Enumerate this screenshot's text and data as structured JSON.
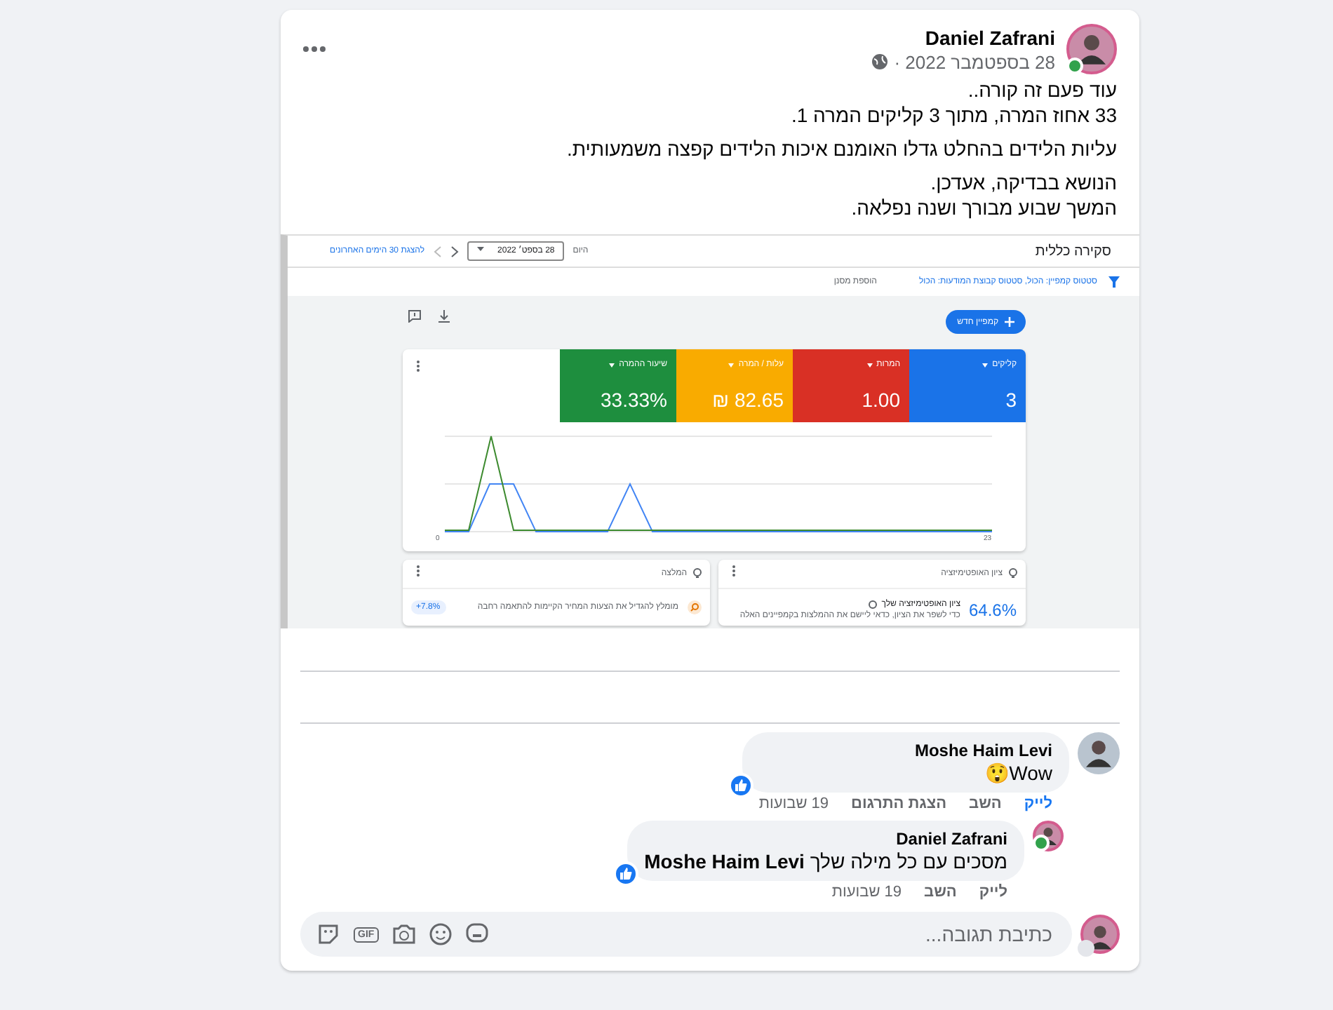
{
  "post": {
    "author": "Daniel Zafrani",
    "date": "28 בספטמבר 2022 ·",
    "online": true,
    "paragraphs": [
      [
        "עוד פעם זה קורה..",
        "33 אחוז המרה, מתוך 3 קליקים המרה 1."
      ],
      [
        "עליות הלידים בהחלט גדלו האומנם איכות הלידים קפצה משמעותית."
      ],
      [
        "הנושא בבדיקה, אעדכן.",
        "המשך שבוע מבורך ושנה נפלאה."
      ]
    ]
  },
  "screenshot": {
    "title": "סקירה כללית",
    "range_label": "היום",
    "date": "28 בספט׳ 2022",
    "range_link": "להצגת 30 הימים האחרונים",
    "filter": "סטטוס קמפיין: הכול, סטטוס קבוצת המודעות: הכול",
    "add_filter": "הוספת מסנן",
    "new_campaign": "קמפיין חדש",
    "tiles": [
      {
        "label": "קליקים",
        "value": "3",
        "color": "#1a73e8"
      },
      {
        "label": "המרות",
        "value": "1.00",
        "color": "#d93025"
      },
      {
        "label": "עלות / המרה",
        "value": "‏82.65 ₪",
        "color": "#f9ab00"
      },
      {
        "label": "שיעור ההמרה",
        "value": "33.33%",
        "color": "#1e8e3e"
      }
    ],
    "axis": [
      "23",
      "0"
    ],
    "cards": [
      {
        "kind": "score",
        "title": "ציון האופטימיזציה",
        "value": "64.6%",
        "heading": "ציון האופטימיזציה שלך",
        "text": "כדי לשפר את הציון, כדאי ליישם את ההמלצות בקמפיינים האלה"
      },
      {
        "kind": "tip",
        "title": "המלצה",
        "text": "מומלץ להגדיל את הצעות המחיר הקיימות להתאמה רחבה",
        "chip": "+7.8%"
      }
    ]
  },
  "comments": [
    {
      "author": "Moshe Haim Levi",
      "text": "Wow😲",
      "liked": true,
      "actions": [
        "לייק",
        "השב",
        "הצגת התרגום"
      ],
      "time": "19 שבועות",
      "replies": [
        {
          "author": "Daniel Zafrani",
          "text": "מסכים עם כל מילה שלך **Moshe Haim Levi**",
          "liked": false,
          "online": true,
          "actions": [
            "לייק",
            "השב"
          ],
          "time": "19 שבועות"
        }
      ]
    }
  ],
  "reply_box": {
    "placeholder": "כתיבת תגובה...",
    "gif_label": "GIF"
  }
}
